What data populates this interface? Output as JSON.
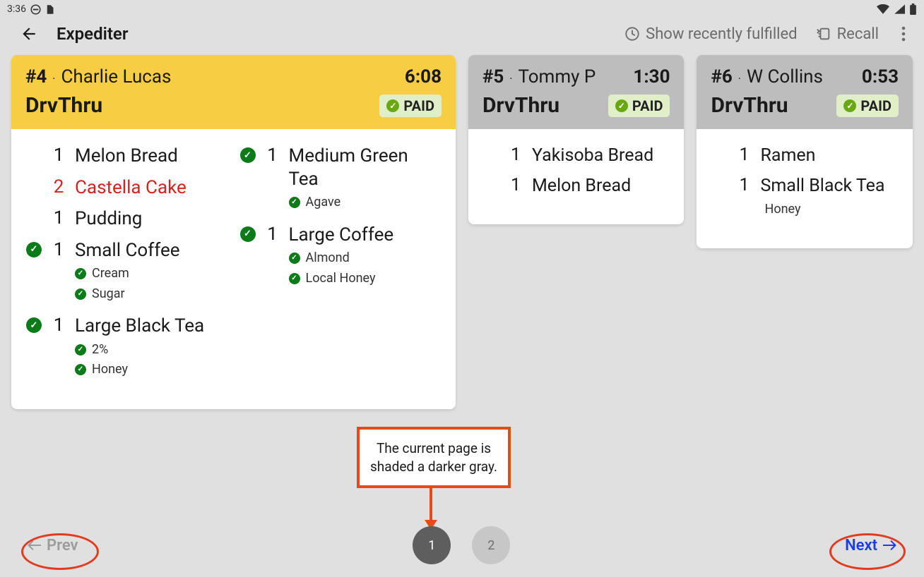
{
  "status": {
    "time": "3:36"
  },
  "app": {
    "title": "Expediter",
    "actions": {
      "recent": "Show recently fulfilled",
      "recall": "Recall"
    }
  },
  "tickets": [
    {
      "num": "#4",
      "name": "Charlie Lucas",
      "elapsed": "6:08",
      "channel": "DrvThru",
      "paid": "PAID",
      "highlight": true,
      "columns": [
        [
          {
            "qty": "1",
            "name": "Melon Bread",
            "done": false,
            "red": false
          },
          {
            "qty": "2",
            "name": "Castella Cake",
            "done": false,
            "red": true
          },
          {
            "qty": "1",
            "name": "Pudding",
            "done": false,
            "red": false
          },
          {
            "qty": "1",
            "name": "Small Coffee",
            "done": true,
            "mods": [
              "Cream",
              "Sugar"
            ]
          },
          {
            "qty": "1",
            "name": "Large Black Tea",
            "done": true,
            "mods": [
              "2%",
              "Honey"
            ]
          }
        ],
        [
          {
            "qty": "1",
            "name": "Medium Green Tea",
            "done": true,
            "mods": [
              "Agave"
            ]
          },
          {
            "qty": "1",
            "name": "Large Coffee",
            "done": true,
            "mods": [
              "Almond",
              "Local Honey"
            ]
          }
        ]
      ]
    },
    {
      "num": "#5",
      "name": "Tommy P",
      "elapsed": "1:30",
      "channel": "DrvThru",
      "paid": "PAID",
      "highlight": false,
      "columns": [
        [
          {
            "qty": "1",
            "name": "Yakisoba Bread",
            "done": false
          },
          {
            "qty": "1",
            "name": "Melon Bread",
            "done": false
          }
        ]
      ]
    },
    {
      "num": "#6",
      "name": "W Collins",
      "elapsed": "0:53",
      "channel": "DrvThru",
      "paid": "PAID",
      "highlight": false,
      "columns": [
        [
          {
            "qty": "1",
            "name": "Ramen",
            "done": false
          },
          {
            "qty": "1",
            "name": "Small Black Tea",
            "done": false,
            "mods_plain": [
              "Honey"
            ]
          }
        ]
      ]
    }
  ],
  "nav": {
    "prev": "Prev",
    "next": "Next",
    "pages": [
      "1",
      "2"
    ],
    "current": 0
  },
  "annotation": "The current page is shaded a darker gray."
}
